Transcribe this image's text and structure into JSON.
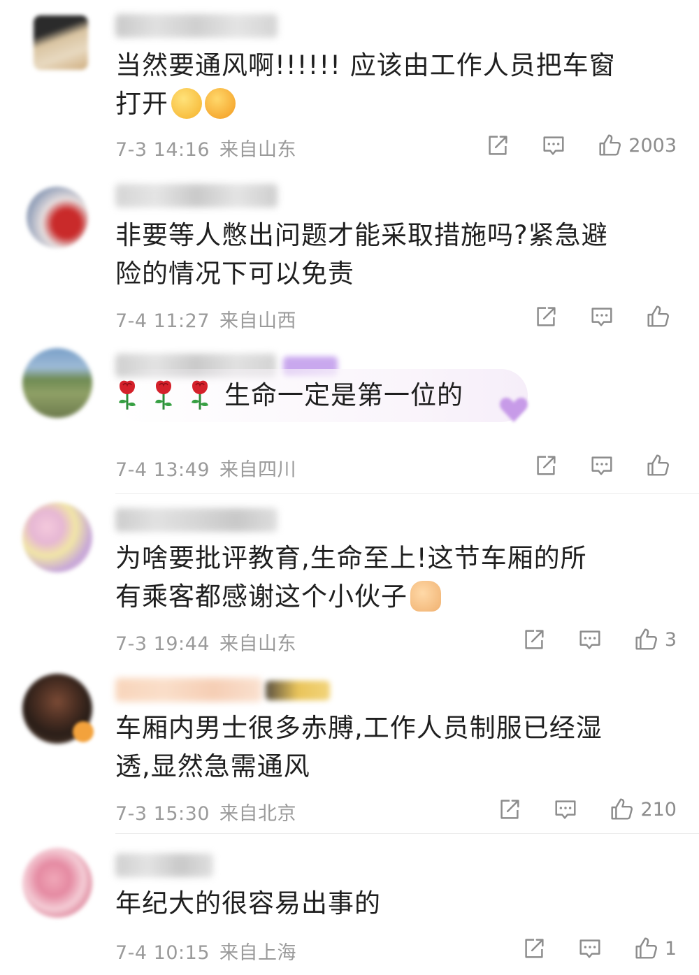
{
  "comments": [
    {
      "text_line1": "当然要通风啊!!!!!!  应该由工作人员把车窗",
      "text_line2": "打开",
      "emojis": [
        "grinning-squint-emoji",
        "crying-shouting-emoji"
      ],
      "date": "7-3 14:16",
      "location": "来自山东",
      "like_count": "2003"
    },
    {
      "text_line1": "非要等人憋出问题才能采取措施吗?紧急避",
      "text_line2": "险的情况下可以免责",
      "date": "7-4 11:27",
      "location": "来自山西",
      "like_count": ""
    },
    {
      "text_line1": "生命一定是第一位的",
      "emojis": [
        "rose-icon",
        "rose-icon",
        "rose-icon"
      ],
      "date": "7-4 13:49",
      "location": "来自四川",
      "like_count": ""
    },
    {
      "text_line1": "为啥要批评教育,生命至上!这节车厢的所",
      "text_line2": "有乘客都感谢这个小伙子",
      "emojis": [
        "thumbs-up-emoji"
      ],
      "date": "7-3 19:44",
      "location": "来自山东",
      "like_count": "3"
    },
    {
      "text_line1": "车厢内男士很多赤膊,工作人员制服已经湿",
      "text_line2": "透,显然急需通风",
      "date": "7-3 15:30",
      "location": "来自北京",
      "like_count": "210"
    },
    {
      "text_line1": "年纪大的很容易出事的",
      "date": "7-4 10:15",
      "location": "来自上海",
      "like_count": "1"
    }
  ],
  "icons": {
    "share": "share-icon",
    "reply": "reply-icon",
    "like": "thumbs-up-icon"
  },
  "colors": {
    "meta_text": "#9a9a9a",
    "icon": "#8c8c8c",
    "divider": "#ececec"
  }
}
